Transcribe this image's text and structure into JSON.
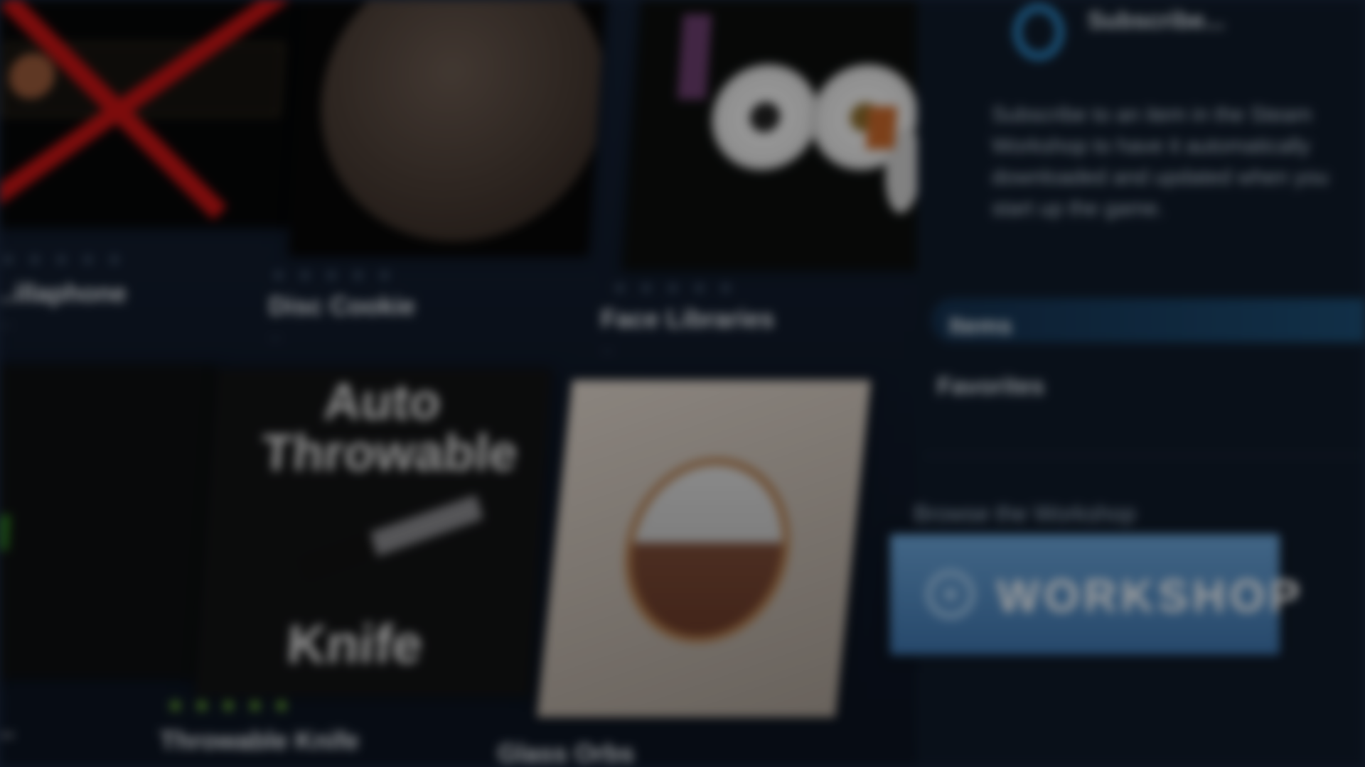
{
  "cards": [
    {
      "title": "...illaphone",
      "author": "...",
      "stars": 0
    },
    {
      "title": "Disc Cookie",
      "author": "...",
      "stars": 0
    },
    {
      "title": "Face Libraries",
      "author": "...",
      "stars": 0
    },
    {
      "title": "...",
      "author": "",
      "stars": 0
    },
    {
      "title": "Throwable Knife",
      "author": "...",
      "stars": 5
    },
    {
      "title": "Glass Orbs",
      "author": "",
      "stars": 0
    }
  ],
  "knife_thumb": {
    "top_text": "Auto Throwable",
    "bottom_text": "Knife"
  },
  "sidebar": {
    "subscribed_label": "Subscribe...",
    "description": "Subscribe to an item in the Steam Workshop to have it automatically downloaded and updated when you start up the game.",
    "tab_active": "Items",
    "tab_second": "Favorites",
    "browse_label": "Browse the Workshop",
    "workshop_button": "WORKSHOP"
  },
  "colors": {
    "accent": "#1b4f77",
    "stars_on": "#7fd13b",
    "workshop": "#4d86c1"
  }
}
